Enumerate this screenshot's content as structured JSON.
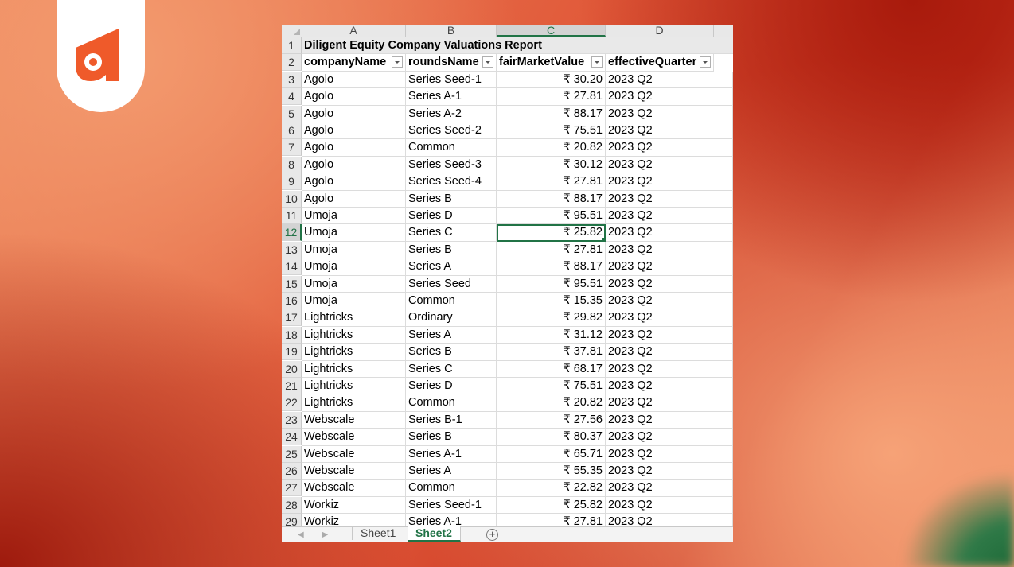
{
  "brand": {
    "logo_name": "orange-brand-logo",
    "accent": "#ef5a2a"
  },
  "spreadsheet": {
    "column_headers": [
      "A",
      "B",
      "C",
      "D"
    ],
    "title": "Diligent Equity Company Valuations Report",
    "headers": [
      "companyName",
      "roundsName",
      "fairMarketValue",
      "effectiveQuarter"
    ],
    "selected_row": 12,
    "rows": [
      [
        "Agolo",
        "Series Seed-1",
        "₹ 30.20",
        "2023 Q2"
      ],
      [
        "Agolo",
        "Series A-1",
        "₹ 27.81",
        "2023 Q2"
      ],
      [
        "Agolo",
        "Series A-2",
        "₹ 88.17",
        "2023 Q2"
      ],
      [
        "Agolo",
        "Series Seed-2",
        "₹ 75.51",
        "2023 Q2"
      ],
      [
        "Agolo",
        "Common",
        "₹ 20.82",
        "2023 Q2"
      ],
      [
        "Agolo",
        "Series Seed-3",
        "₹ 30.12",
        "2023 Q2"
      ],
      [
        "Agolo",
        "Series Seed-4",
        "₹ 27.81",
        "2023 Q2"
      ],
      [
        "Agolo",
        "Series B",
        "₹ 88.17",
        "2023 Q2"
      ],
      [
        "Umoja",
        "Series D",
        "₹ 95.51",
        "2023 Q2"
      ],
      [
        "Umoja",
        "Series C",
        "₹ 25.82",
        "2023 Q2"
      ],
      [
        "Umoja",
        "Series B",
        "₹ 27.81",
        "2023 Q2"
      ],
      [
        "Umoja",
        "Series A",
        "₹ 88.17",
        "2023 Q2"
      ],
      [
        "Umoja",
        "Series Seed",
        "₹ 95.51",
        "2023 Q2"
      ],
      [
        "Umoja",
        "Common",
        "₹ 15.35",
        "2023 Q2"
      ],
      [
        "Lightricks",
        "Ordinary",
        "₹ 29.82",
        "2023 Q2"
      ],
      [
        "Lightricks",
        "Series A",
        "₹ 31.12",
        "2023 Q2"
      ],
      [
        "Lightricks",
        "Series B",
        "₹ 37.81",
        "2023 Q2"
      ],
      [
        "Lightricks",
        "Series C",
        "₹ 68.17",
        "2023 Q2"
      ],
      [
        "Lightricks",
        "Series D",
        "₹ 75.51",
        "2023 Q2"
      ],
      [
        "Lightricks",
        "Common",
        "₹ 20.82",
        "2023 Q2"
      ],
      [
        "Webscale",
        "Series B-1",
        "₹ 27.56",
        "2023 Q2"
      ],
      [
        "Webscale",
        "Series B",
        "₹ 80.37",
        "2023 Q2"
      ],
      [
        "Webscale",
        "Series A-1",
        "₹ 65.71",
        "2023 Q2"
      ],
      [
        "Webscale",
        "Series A",
        "₹ 55.35",
        "2023 Q2"
      ],
      [
        "Webscale",
        "Common",
        "₹ 22.82",
        "2023 Q2"
      ],
      [
        "Workiz",
        "Series Seed-1",
        "₹ 25.82",
        "2023 Q2"
      ],
      [
        "Workiz",
        "Series A-1",
        "₹ 27.81",
        "2023 Q2"
      ]
    ],
    "tabs": [
      "Sheet1",
      "Sheet2"
    ],
    "active_tab": "Sheet2",
    "add_sheet_icon": "plus-circle-icon"
  }
}
